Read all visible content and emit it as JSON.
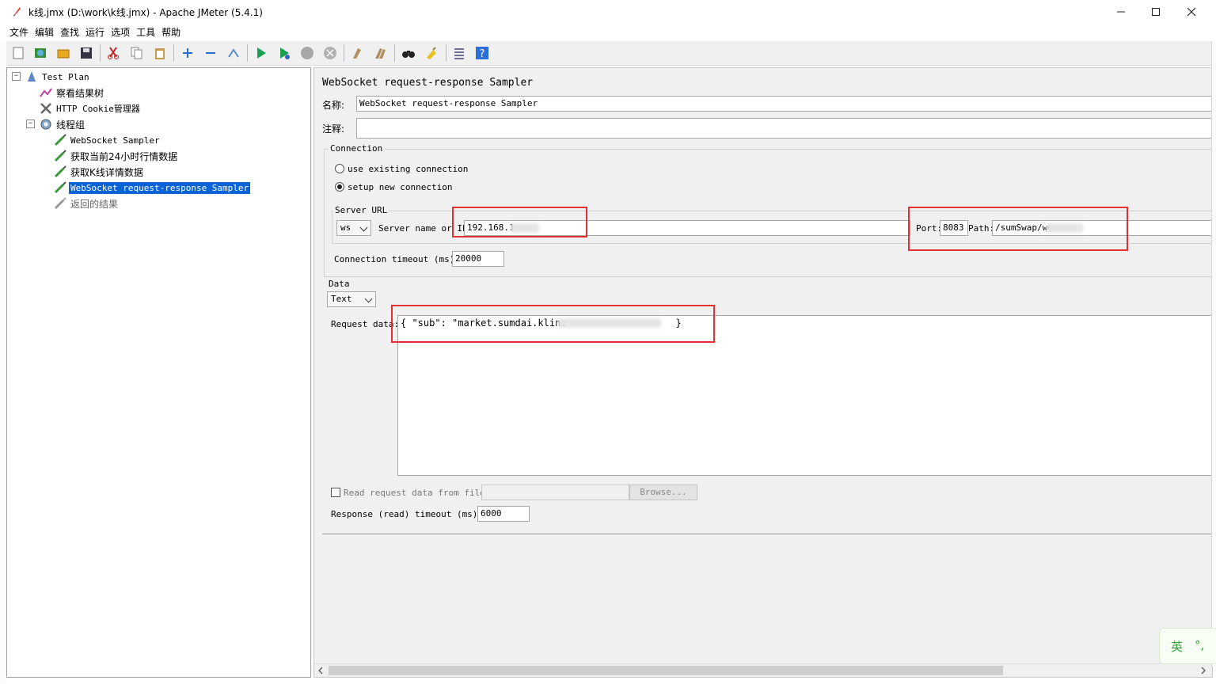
{
  "window": {
    "title": "k线.jmx (D:\\work\\k线.jmx) - Apache JMeter (5.4.1)",
    "minimize": "—",
    "maximize": "☐",
    "close": "✕"
  },
  "menu": [
    "文件",
    "编辑",
    "查找",
    "运行",
    "选项",
    "工具",
    "帮助"
  ],
  "toolbar": {
    "icons": [
      "new-icon",
      "templates-icon",
      "open-icon",
      "save-icon",
      "cut-icon",
      "copy-icon",
      "paste-icon",
      "expand-icon",
      "collapse-icon",
      "toggle-icon",
      "start-icon",
      "start-no-pause-icon",
      "stop-icon",
      "shutdown-icon",
      "clear-icon",
      "clear-all-icon",
      "search-icon",
      "reset-search-icon",
      "function-helper-icon",
      "help-icon"
    ]
  },
  "tree": {
    "nodes": [
      {
        "label": "Test Plan",
        "icon": "test-plan-icon"
      },
      {
        "label": "察看结果树",
        "icon": "results-tree-icon"
      },
      {
        "label": "HTTP Cookie管理器",
        "icon": "cookie-manager-icon"
      },
      {
        "label": "线程组",
        "icon": "thread-group-icon"
      },
      {
        "label": "WebSocket Sampler",
        "icon": "sampler-icon"
      },
      {
        "label": "获取当前24小时行情数据",
        "icon": "sampler-icon"
      },
      {
        "label": "获取K线详情数据",
        "icon": "sampler-icon"
      },
      {
        "label": "WebSocket request-response Sampler",
        "icon": "sampler-icon"
      },
      {
        "label": "返回的结果",
        "icon": "sampler-icon"
      }
    ]
  },
  "sampler": {
    "heading": "WebSocket request-response Sampler",
    "name_label": "名称:",
    "name_value": "WebSocket request-response Sampler",
    "comment_label": "注释:",
    "comment_value": "",
    "connection": {
      "title": "Connection",
      "option_existing": "use existing connection",
      "option_new": "setup new connection",
      "selected": "setup new connection"
    },
    "server_url": {
      "title": "Server URL",
      "protocol": "ws",
      "server_label": "Server name or IP:",
      "server_value": "192.168.1",
      "port_label": "Port:",
      "port_value": "8083",
      "path_label": "Path:",
      "path_value": "/sumSwap/we"
    },
    "connection_timeout_label": "Connection timeout (ms):",
    "connection_timeout_value": "20000",
    "data": {
      "title": "Data",
      "type": "Text",
      "request_label": "Request data:",
      "request_value": "{ \"sub\": \"market.sumdai.kline",
      "request_tail": "}",
      "read_from_file_label": "Read request data from file:",
      "read_from_file_checked": false,
      "browse_label": "Browse..."
    },
    "response_timeout_label": "Response (read) timeout (ms):",
    "response_timeout_value": "6000"
  },
  "ime": {
    "lang": "英",
    "punct": "°,"
  }
}
